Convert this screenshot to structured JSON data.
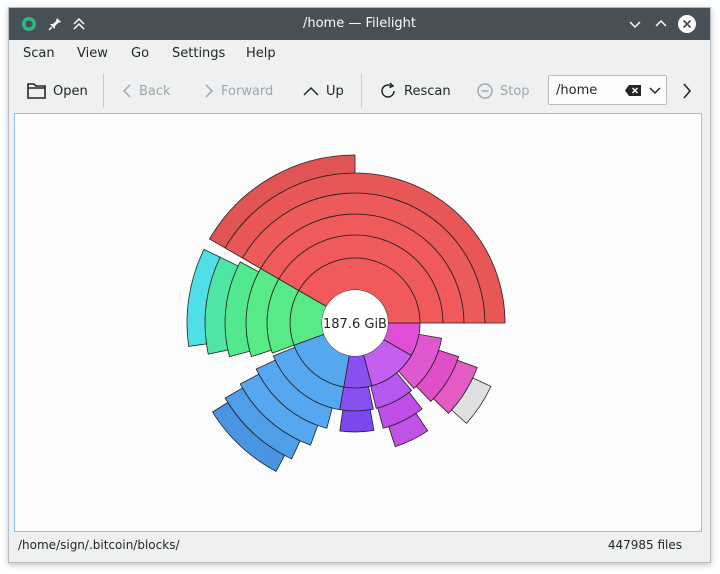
{
  "window": {
    "title": "/home — Filelight"
  },
  "menubar": {
    "items": [
      "Scan",
      "View",
      "Go",
      "Settings",
      "Help"
    ]
  },
  "toolbar": {
    "open": "Open",
    "back": "Back",
    "forward": "Forward",
    "up": "Up",
    "rescan": "Rescan",
    "stop": "Stop",
    "location": "/home"
  },
  "chart": {
    "center_label": "187.6 GiB"
  },
  "status": {
    "path": "/home/sign/.bitcoin/blocks/",
    "files": "447985 files"
  },
  "colors": {
    "titlebar": "#475057",
    "red": "#f05a5a",
    "green": "#58ea86",
    "blue": "#55a8f0",
    "violet": "#8a4ff0",
    "magenta": "#e04ed8",
    "cyan": "#4ee0e6"
  }
}
